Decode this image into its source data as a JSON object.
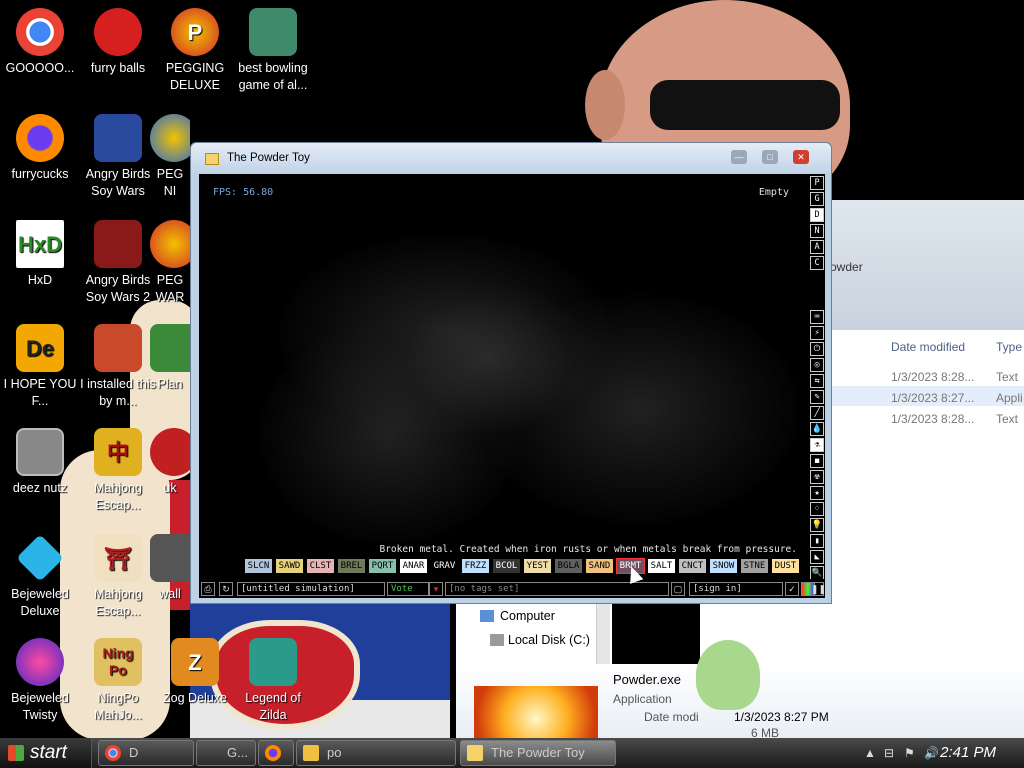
{
  "desktop": {
    "icons": [
      {
        "label": "GOOOOO...",
        "icon": "chrome-icon"
      },
      {
        "label": "furry balls",
        "icon": "furball-icon"
      },
      {
        "label": "PEGGING DELUXE",
        "icon": "peggle-icon"
      },
      {
        "label": "best bowling game of al...",
        "icon": "bowling-icon"
      },
      {
        "label": "furrycucks",
        "icon": "firefox-icon"
      },
      {
        "label": "Angry Birds Soy Wars",
        "icon": "angry-birds-icon"
      },
      {
        "label": "PEG NI",
        "icon": "peggle-icon"
      },
      {
        "label": "HxD",
        "icon": "hxd-icon"
      },
      {
        "label": "Angry Birds Soy Wars 2",
        "icon": "angry-birds-icon"
      },
      {
        "label": "PEG WAR",
        "icon": "peggle-icon"
      },
      {
        "label": "I HOPE YOU F...",
        "icon": "de-icon"
      },
      {
        "label": "I installed this by m...",
        "icon": "game-icon"
      },
      {
        "label": "Plan",
        "icon": "plant-icon"
      },
      {
        "label": "deez nutz",
        "icon": "folder-stack-icon"
      },
      {
        "label": "Mahjong Escap...",
        "icon": "mahjong-icon"
      },
      {
        "label": "uk",
        "icon": "game-icon"
      },
      {
        "label": "Bejeweled Deluxe",
        "icon": "bejeweled-icon"
      },
      {
        "label": "Mahjong Escap...",
        "icon": "mahjong-icon"
      },
      {
        "label": "wall",
        "icon": "game-icon"
      },
      {
        "label": "Bejeweled Twisty",
        "icon": "bejeweled-twist-icon"
      },
      {
        "label": "NingPo MahJo...",
        "icon": "ningpo-icon"
      },
      {
        "label": "Zog Deluxe",
        "icon": "zog-icon"
      },
      {
        "label": "Legend of Zilda",
        "icon": "zilda-icon"
      }
    ]
  },
  "explorer": {
    "path_text": "owder",
    "columns": {
      "date": "Date modified",
      "type": "Type"
    },
    "rows": [
      {
        "date": "1/3/2023 8:28...",
        "type": "Text"
      },
      {
        "date": "1/3/2023 8:27...",
        "type": "Appli"
      },
      {
        "date": "1/3/2023 8:28...",
        "type": "Text"
      }
    ],
    "nav": {
      "computer": "Computer",
      "local_disk": "Local Disk (C:)"
    },
    "details": {
      "name": "Powder.exe",
      "kind": "Application",
      "date_label": "Date modi",
      "date_value": "1/3/2023 8:27 PM",
      "size_fragment": "6 MB"
    }
  },
  "powder_toy": {
    "title": "The Powder Toy",
    "fps": "FPS: 56.80",
    "hover": "Empty",
    "description": "Broken metal. Created when iron rusts or when metals break from pressure.",
    "side_modes": [
      "P",
      "G",
      "D",
      "N",
      "A",
      "C"
    ],
    "side_tools": [
      "⌨",
      "⚡",
      "⏻",
      "◎",
      "⇆",
      "✎",
      "╱",
      "💧",
      "⚗",
      "◼",
      "☢",
      "★",
      "⁘",
      "💡",
      "▮",
      "◣",
      "🔍"
    ],
    "elements": [
      {
        "name": "SLCN",
        "color": "#b0c4de"
      },
      {
        "name": "SAWD",
        "color": "#e6d27a"
      },
      {
        "name": "CLST",
        "color": "#e6b4b4"
      },
      {
        "name": "BREL",
        "color": "#6e7a5a"
      },
      {
        "name": "PQRT",
        "color": "#88c0b0"
      },
      {
        "name": "ANAR",
        "color": "#ffffff"
      },
      {
        "name": "GRAV",
        "color": "#000000"
      },
      {
        "name": "FRZZ",
        "color": "#c0e0ff"
      },
      {
        "name": "BCOL",
        "color": "#333333"
      },
      {
        "name": "YEST",
        "color": "#eeddaa"
      },
      {
        "name": "BGLA",
        "color": "#606060"
      },
      {
        "name": "SAND",
        "color": "#f0c080"
      },
      {
        "name": "BRMT",
        "color": "#705060"
      },
      {
        "name": "SALT",
        "color": "#ffffff"
      },
      {
        "name": "CNCT",
        "color": "#c0c0c0"
      },
      {
        "name": "SNOW",
        "color": "#c0e0ff"
      },
      {
        "name": "STNE",
        "color": "#a0a0a0"
      },
      {
        "name": "DUST",
        "color": "#ffe0a0"
      }
    ],
    "bottom": {
      "save_name": "[untitled simulation]",
      "vote": "Vote",
      "tags": "[no tags set]",
      "signin": "[sign in]"
    }
  },
  "taskbar": {
    "start": "start",
    "items": [
      {
        "label": "D",
        "icon": "chrome-icon"
      },
      {
        "label": "G...",
        "icon": "app-icon"
      },
      {
        "label": "",
        "icon": "firefox-icon"
      },
      {
        "label": "po",
        "icon": "folder-icon"
      },
      {
        "label": "The Powder Toy",
        "icon": "powder-toy-icon"
      }
    ],
    "clock": "2:41 PM"
  }
}
